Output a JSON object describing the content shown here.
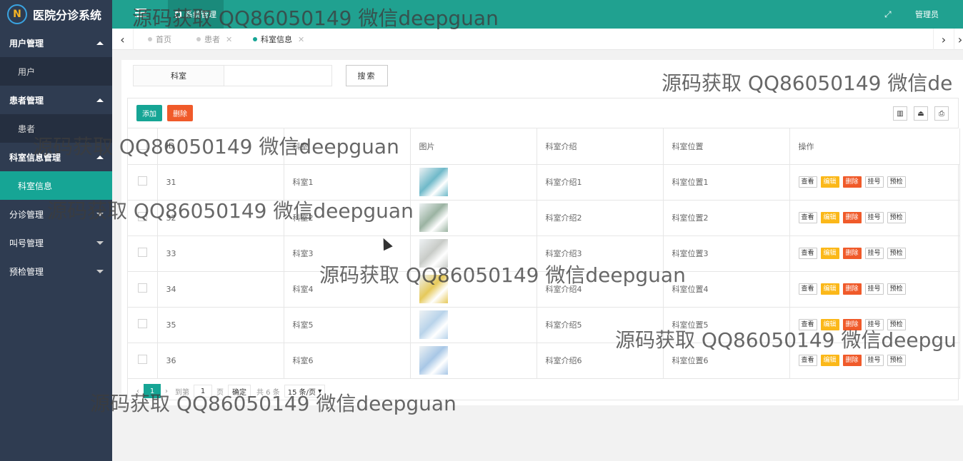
{
  "app": {
    "title": "医院分诊系统",
    "logo_letter": "N"
  },
  "sidebar": {
    "groups": [
      {
        "label": "用户管理",
        "sub": "用户"
      },
      {
        "label": "患者管理",
        "sub": "患者"
      },
      {
        "label": "科室信息管理",
        "sub": "科室信息"
      },
      {
        "label": "分诊管理"
      },
      {
        "label": "叫号管理"
      },
      {
        "label": "预检管理"
      }
    ]
  },
  "header": {
    "tab_label": "系统管理",
    "user": "管理员",
    "full_icon": "⤢"
  },
  "tabs": [
    {
      "label": "首页"
    },
    {
      "label": "患者"
    },
    {
      "label": "科室信息"
    }
  ],
  "search": {
    "label": "科室",
    "value": "",
    "button": "搜索"
  },
  "toolbar": {
    "add": "添加",
    "delete": "删除"
  },
  "table": {
    "headers": [
      "ID",
      "科室",
      "图片",
      "科室介绍",
      "科室位置",
      "操作"
    ],
    "ops": [
      "查看",
      "编辑",
      "删除",
      "挂号",
      "预检"
    ],
    "rows": [
      {
        "id": "31",
        "name": "科室1",
        "intro": "科室介绍1",
        "loc": "科室位置1",
        "img": "#6fb9c9"
      },
      {
        "id": "32",
        "name": "科室2",
        "intro": "科室介绍2",
        "loc": "科室位置2",
        "img": "#9bb3a2"
      },
      {
        "id": "33",
        "name": "科室3",
        "intro": "科室介绍3",
        "loc": "科室位置3",
        "img": "#c8cbc7"
      },
      {
        "id": "34",
        "name": "科室4",
        "intro": "科室介绍4",
        "loc": "科室位置4",
        "img": "#e6c95a"
      },
      {
        "id": "35",
        "name": "科室5",
        "intro": "科室介绍5",
        "loc": "科室位置5",
        "img": "#b8d3ea"
      },
      {
        "id": "36",
        "name": "科室6",
        "intro": "科室介绍6",
        "loc": "科室位置6",
        "img": "#a8c7e6"
      }
    ]
  },
  "pager": {
    "current": "1",
    "goto": "到第",
    "page_value": "1",
    "page_unit": "页",
    "confirm": "确定",
    "total": "共 6 条",
    "per_page": "15 条/页"
  },
  "watermark": "源码获取 QQ86050149 微信deepguan",
  "watermark_short1": "源码获取 QQ86050149 微信de",
  "watermark_short2": "源码获取 QQ86050149 微信deepgu"
}
